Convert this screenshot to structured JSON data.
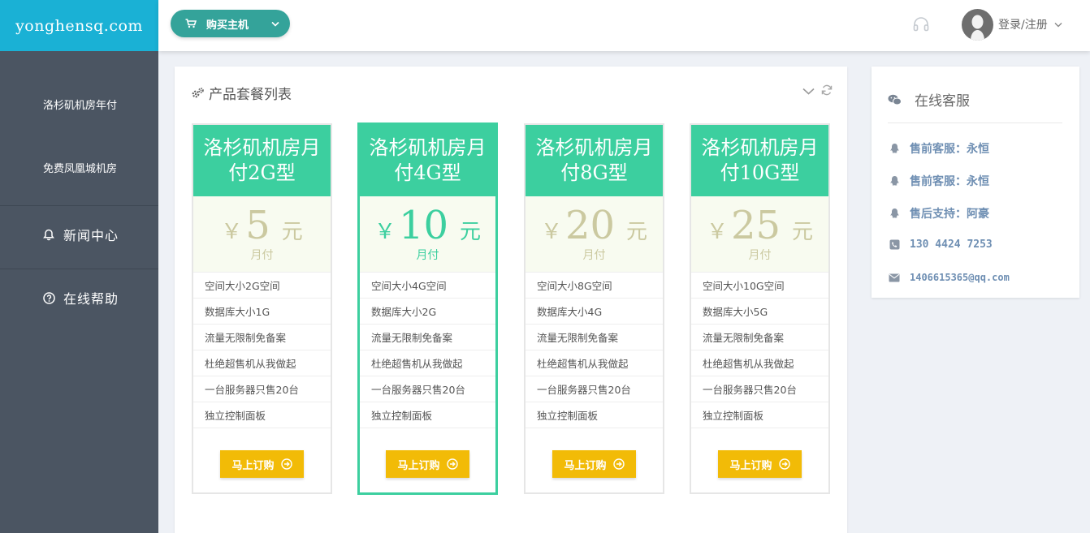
{
  "site": {
    "logo_text": "yonghensq.com"
  },
  "sidebar": {
    "items": [
      {
        "label": "洛杉矶机房年付",
        "icon": "none"
      },
      {
        "label": "免费凤凰城机房",
        "icon": "none"
      },
      {
        "label": "新闻中心",
        "icon": "bell-icon"
      },
      {
        "label": "在线帮助",
        "icon": "help-circle-icon"
      }
    ]
  },
  "topbar": {
    "buy_label": "购买主机",
    "login_label": "登录/注册"
  },
  "products": {
    "title": "产品套餐列表",
    "order_label": "马上订购",
    "plans": [
      {
        "name": "洛杉矶机房月付2G型",
        "currency": "￥",
        "price": "5",
        "unit": "元",
        "period": "月付",
        "features": [
          "空间大小2G空间",
          "数据库大小1G",
          "流量无限制免备案",
          "杜绝超售机从我做起",
          "一台服务器只售20台",
          "独立控制面板"
        ]
      },
      {
        "name": "洛杉矶机房月付4G型",
        "currency": "￥",
        "price": "10",
        "unit": "元",
        "period": "月付",
        "highlighted": true,
        "features": [
          "空间大小4G空间",
          "数据库大小2G",
          "流量无限制免备案",
          "杜绝超售机从我做起",
          "一台服务器只售20台",
          "独立控制面板"
        ]
      },
      {
        "name": "洛杉矶机房月付8G型",
        "currency": "￥",
        "price": "20",
        "unit": "元",
        "period": "月付",
        "features": [
          "空间大小8G空间",
          "数据库大小4G",
          "流量无限制免备案",
          "杜绝超售机从我做起",
          "一台服务器只售20台",
          "独立控制面板"
        ]
      },
      {
        "name": "洛杉矶机房月付10G型",
        "currency": "￥",
        "price": "25",
        "unit": "元",
        "period": "月付",
        "features": [
          "空间大小10G空间",
          "数据库大小5G",
          "流量无限制免备案",
          "杜绝超售机从我做起",
          "一台服务器只售20台",
          "独立控制面板"
        ]
      }
    ]
  },
  "support": {
    "title": "在线客服",
    "rows": [
      {
        "label": "售前客服：永恒",
        "icon": "qq-icon"
      },
      {
        "label": "售前客服：永恒",
        "icon": "qq-icon"
      },
      {
        "label": "售后支持：阿豪",
        "icon": "qq-icon"
      },
      {
        "label": "130 4424 7253",
        "icon": "phone-icon"
      },
      {
        "label": "1406615365@qq.com",
        "icon": "mail-icon"
      }
    ]
  },
  "colors": {
    "logo_bg": "#1ab1d5",
    "sidebar_bg": "#4b5562",
    "buy_button": "#34a39a",
    "card_header": "#3ccf9f",
    "order_button": "#f2bb07",
    "support_text": "#6f8fb3"
  }
}
